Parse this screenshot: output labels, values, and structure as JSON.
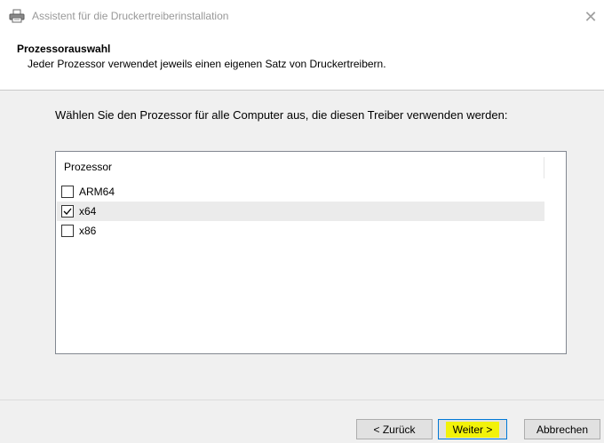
{
  "window": {
    "title": "Assistent für die Druckertreiberinstallation",
    "app_icon": "printer-icon",
    "close_icon": "close-icon",
    "close_glyph": "✕"
  },
  "header": {
    "title": "Prozessorauswahl",
    "subtitle": "Jeder Prozessor verwendet jeweils einen eigenen Satz von Druckertreibern."
  },
  "main": {
    "instruction": "Wählen Sie den Prozessor für alle Computer aus, die diesen Treiber verwenden werden:",
    "list": {
      "column_header": "Prozessor",
      "items": [
        {
          "label": "ARM64",
          "checked": false
        },
        {
          "label": "x64",
          "checked": true
        },
        {
          "label": "x86",
          "checked": false
        }
      ]
    }
  },
  "footer": {
    "back_label": "< Zurück",
    "next_label": "Weiter >",
    "cancel_label": "Abbrechen"
  },
  "colors": {
    "highlight": "#f2f20a",
    "focus_border": "#0078d7",
    "panel_bg": "#f0f0f0"
  }
}
